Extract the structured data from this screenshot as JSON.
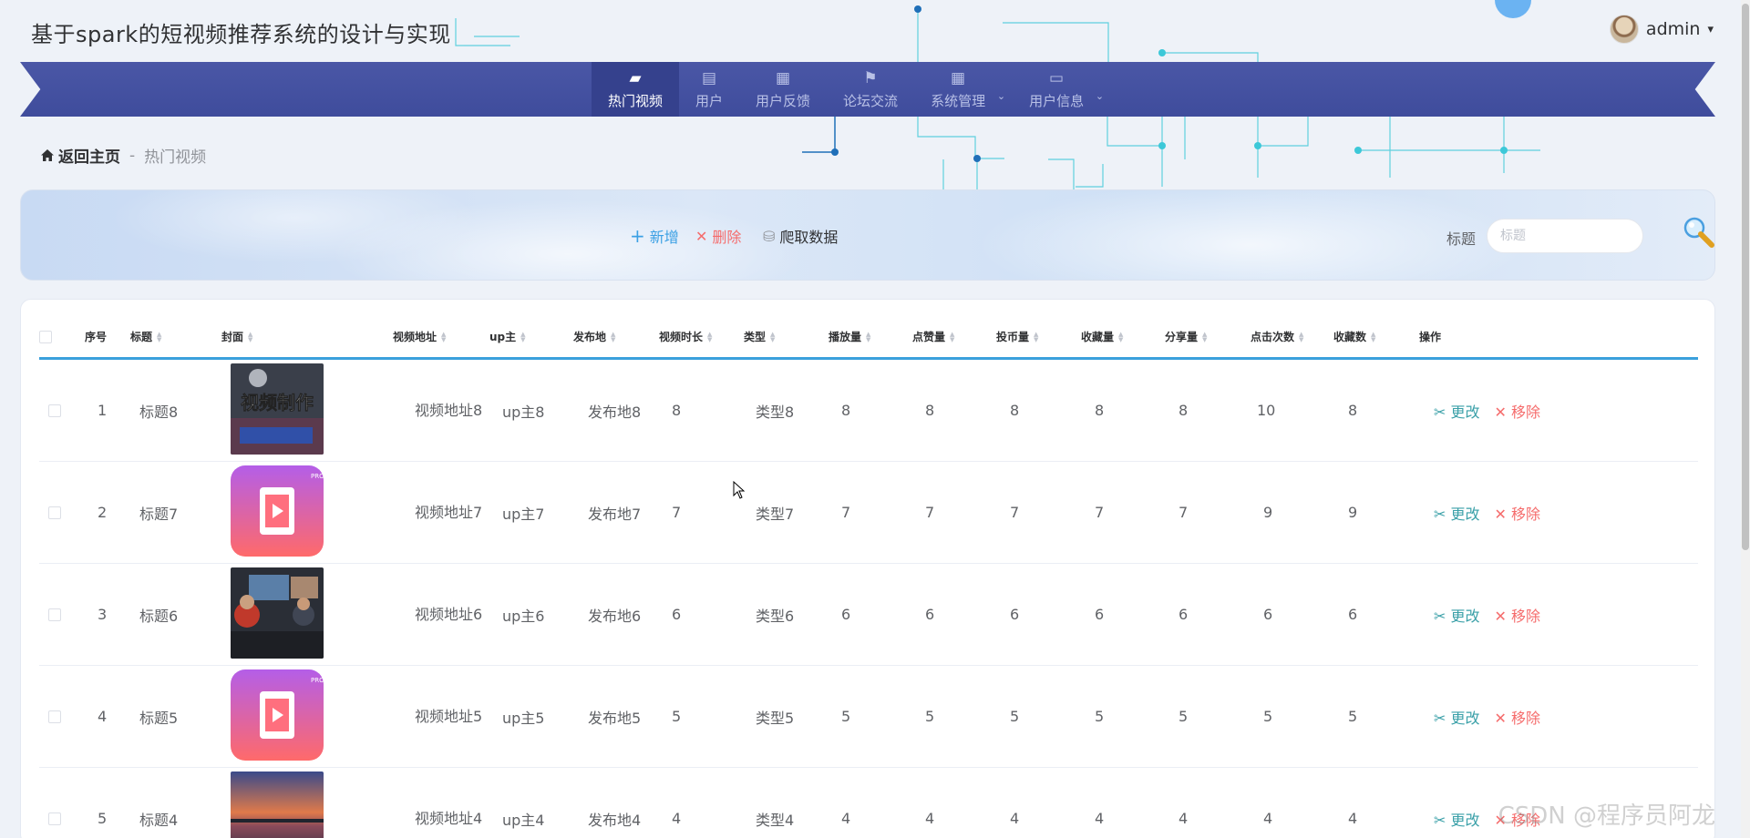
{
  "app": {
    "title": "基于spark的短视频推荐系统的设计与实现"
  },
  "user": {
    "name": "admin",
    "caret": "▾"
  },
  "nav": {
    "items": [
      {
        "label": "热门视频",
        "icon": "wallet-icon",
        "glyph": "▰",
        "active": true,
        "dropdown": false
      },
      {
        "label": "用户",
        "icon": "clipboard-icon",
        "glyph": "▤",
        "active": false,
        "dropdown": false
      },
      {
        "label": "用户反馈",
        "icon": "grid-icon",
        "glyph": "▦",
        "active": false,
        "dropdown": false
      },
      {
        "label": "论坛交流",
        "icon": "flag-icon",
        "glyph": "⚑",
        "active": false,
        "dropdown": false
      },
      {
        "label": "系统管理",
        "icon": "grid-icon",
        "glyph": "▦",
        "active": false,
        "dropdown": true
      },
      {
        "label": "用户信息",
        "icon": "calendar-icon",
        "glyph": "▭",
        "active": false,
        "dropdown": true
      }
    ],
    "dropdown_caret": "⌄"
  },
  "breadcrumb": {
    "home": "返回主页",
    "separator": "-",
    "current": "热门视频"
  },
  "toolbar": {
    "add_label": "新增",
    "delete_label": "删除",
    "crawl_label": "爬取数据",
    "add_glyph": "+",
    "delete_glyph": "✕",
    "crawl_glyph": "⛁",
    "search_label": "标题",
    "search_placeholder": "标题"
  },
  "table": {
    "columns": [
      "序号",
      "标题",
      "封面",
      "视频地址",
      "up主",
      "发布地",
      "视频时长",
      "类型",
      "播放量",
      "点赞量",
      "投币量",
      "收藏量",
      "分享量",
      "点击次数",
      "收藏数",
      "操作"
    ],
    "edit_label": "更改",
    "remove_label": "移除",
    "edit_glyph": "✂",
    "remove_glyph": "✕",
    "rows": [
      {
        "no": "1",
        "title": "标题8",
        "cover": "video-production-thumbnail",
        "url": "视频地址8",
        "up": "up主8",
        "place": "发布地8",
        "duration": "8",
        "type": "类型8",
        "plays": "8",
        "likes": "8",
        "coins": "8",
        "favs": "8",
        "shares": "8",
        "clicks": "10",
        "collects": "8"
      },
      {
        "no": "2",
        "title": "标题7",
        "cover": "video-app-icon-thumbnail",
        "url": "视频地址7",
        "up": "up主7",
        "place": "发布地7",
        "duration": "7",
        "type": "类型7",
        "plays": "7",
        "likes": "7",
        "coins": "7",
        "favs": "7",
        "shares": "7",
        "clicks": "9",
        "collects": "9"
      },
      {
        "no": "3",
        "title": "标题6",
        "cover": "editing-studio-thumbnail",
        "url": "视频地址6",
        "up": "up主6",
        "place": "发布地6",
        "duration": "6",
        "type": "类型6",
        "plays": "6",
        "likes": "6",
        "coins": "6",
        "favs": "6",
        "shares": "6",
        "clicks": "6",
        "collects": "6"
      },
      {
        "no": "4",
        "title": "标题5",
        "cover": "video-app-icon-thumbnail",
        "url": "视频地址5",
        "up": "up主5",
        "place": "发布地5",
        "duration": "5",
        "type": "类型5",
        "plays": "5",
        "likes": "5",
        "coins": "5",
        "favs": "5",
        "shares": "5",
        "clicks": "5",
        "collects": "5"
      },
      {
        "no": "5",
        "title": "标题4",
        "cover": "sunset-lake-thumbnail",
        "url": "视频地址4",
        "up": "up主4",
        "place": "发布地4",
        "duration": "4",
        "type": "类型4",
        "plays": "4",
        "likes": "4",
        "coins": "4",
        "favs": "4",
        "shares": "4",
        "clicks": "4",
        "collects": "4"
      }
    ]
  },
  "watermark": "CSDN @程序员阿龙",
  "colors": {
    "nav_bg": "#4a57a6",
    "nav_active": "#35418d",
    "accent": "#3aa0dc",
    "danger": "#f56c6c",
    "edit": "#3aa0a8"
  }
}
